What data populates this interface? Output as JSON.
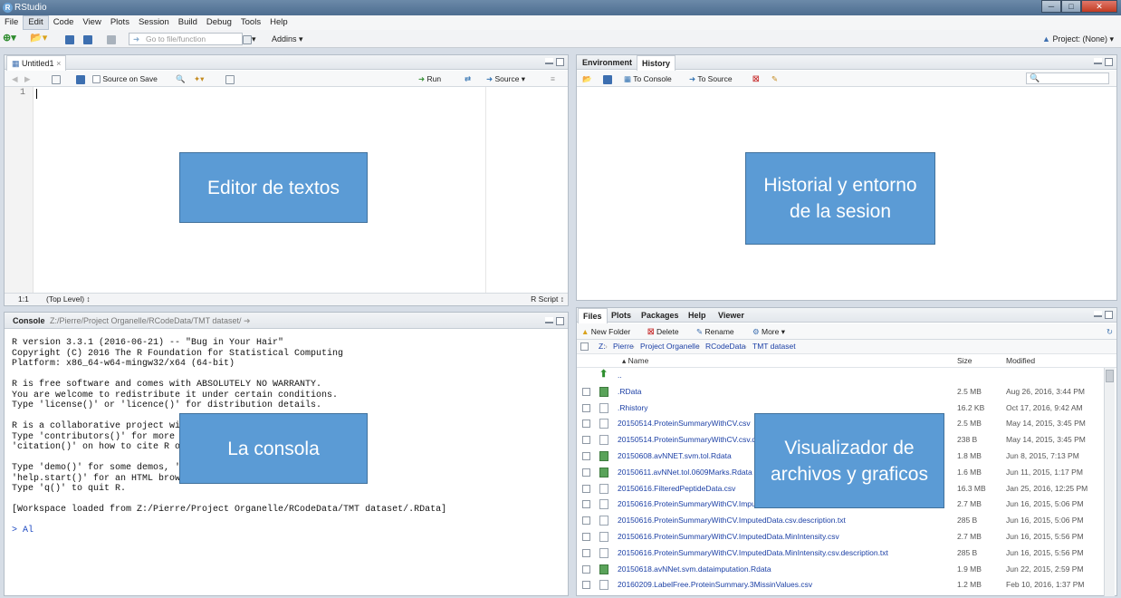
{
  "window": {
    "title": "RStudio",
    "icon": "R"
  },
  "menu": [
    "File",
    "Edit",
    "Code",
    "View",
    "Plots",
    "Session",
    "Build",
    "Debug",
    "Tools",
    "Help"
  ],
  "toolbar": {
    "goto_placeholder": "Go to file/function",
    "addins": "Addins ▾",
    "project": "Project: (None) ▾"
  },
  "editor": {
    "tab": "Untitled1",
    "source_on_save": "Source on Save",
    "run": "Run",
    "source": "Source",
    "line_number": "1",
    "status_position": "1:1",
    "status_scope": "(Top Level) ↕",
    "status_type": "R Script ↕",
    "annotation": "Editor de textos"
  },
  "env": {
    "tabs": [
      "Environment",
      "History"
    ],
    "to_console": "To Console",
    "to_source": "To Source",
    "annotation_line1": "Historial y entorno",
    "annotation_line2": "de la sesion"
  },
  "console": {
    "title": "Console",
    "path": "Z:/Pierre/Project Organelle/RCodeData/TMT dataset/",
    "lines": [
      "R version 3.3.1 (2016-06-21) -- \"Bug in Your Hair\"",
      "Copyright (C) 2016 The R Foundation for Statistical Computing",
      "Platform: x86_64-w64-mingw32/x64 (64-bit)",
      "",
      "R is free software and comes with ABSOLUTELY NO WARRANTY.",
      "You are welcome to redistribute it under certain conditions.",
      "Type 'license()' or 'licence()' for distribution details.",
      "",
      "R is a collaborative project wi",
      "Type 'contributors()' for more",
      "'citation()' on how to cite R o",
      "",
      "Type 'demo()' for some demos, '",
      "'help.start()' for an HTML brow",
      "Type 'q()' to quit R.",
      "",
      "[Workspace loaded from Z:/Pierre/Project Organelle/RCodeData/TMT dataset/.RData]",
      ""
    ],
    "prompt": "> Al",
    "annotation": "La consola"
  },
  "files": {
    "tabs": [
      "Files",
      "Plots",
      "Packages",
      "Help",
      "Viewer"
    ],
    "new_folder": "New Folder",
    "delete": "Delete",
    "rename": "Rename",
    "more": "More ▾",
    "breadcrumb": [
      "Z:",
      "Pierre",
      "Project Organelle",
      "RCodeData",
      "TMT dataset"
    ],
    "col_name": "▴ Name",
    "col_size": "Size",
    "col_modified": "Modified",
    "annotation_line1": "Visualizador de",
    "annotation_line2": "archivos y graficos",
    "rows": [
      {
        "name": "..",
        "size": "",
        "modified": "",
        "icon": "up"
      },
      {
        "name": ".RData",
        "size": "2.5 MB",
        "modified": "Aug 26, 2016, 3:44 PM",
        "icon": "r"
      },
      {
        "name": ".Rhistory",
        "size": "16.2 KB",
        "modified": "Oct 17, 2016, 9:42 AM",
        "icon": "doc"
      },
      {
        "name": "20150514.ProteinSummaryWithCV.csv",
        "size": "2.5 MB",
        "modified": "May 14, 2015, 3:45 PM",
        "icon": "csv"
      },
      {
        "name": "20150514.ProteinSummaryWithCV.csv.description.txt",
        "size": "238 B",
        "modified": "May 14, 2015, 3:45 PM",
        "icon": "doc"
      },
      {
        "name": "20150608.avNNET.svm.tol.Rdata",
        "size": "1.8 MB",
        "modified": "Jun 8, 2015, 7:13 PM",
        "icon": "r"
      },
      {
        "name": "20150611.avNNet.tol.0609Marks.Rdata",
        "size": "1.6 MB",
        "modified": "Jun 11, 2015, 1:17 PM",
        "icon": "r"
      },
      {
        "name": "20150616.FilteredPeptideData.csv",
        "size": "16.3 MB",
        "modified": "Jan 25, 2016, 12:25 PM",
        "icon": "csv"
      },
      {
        "name": "20150616.ProteinSummaryWithCV.ImputedData.csv",
        "size": "2.7 MB",
        "modified": "Jun 16, 2015, 5:06 PM",
        "icon": "csv"
      },
      {
        "name": "20150616.ProteinSummaryWithCV.ImputedData.csv.description.txt",
        "size": "285 B",
        "modified": "Jun 16, 2015, 5:06 PM",
        "icon": "doc"
      },
      {
        "name": "20150616.ProteinSummaryWithCV.ImputedData.MinIntensity.csv",
        "size": "2.7 MB",
        "modified": "Jun 16, 2015, 5:56 PM",
        "icon": "csv"
      },
      {
        "name": "20150616.ProteinSummaryWithCV.ImputedData.MinIntensity.csv.description.txt",
        "size": "285 B",
        "modified": "Jun 16, 2015, 5:56 PM",
        "icon": "doc"
      },
      {
        "name": "20150618.avNNet.svm.dataimputation.Rdata",
        "size": "1.9 MB",
        "modified": "Jun 22, 2015, 2:59 PM",
        "icon": "r"
      },
      {
        "name": "20160209.LabelFree.ProteinSummary.3MissinValues.csv",
        "size": "1.2 MB",
        "modified": "Feb 10, 2016, 1:37 PM",
        "icon": "csv"
      }
    ]
  }
}
